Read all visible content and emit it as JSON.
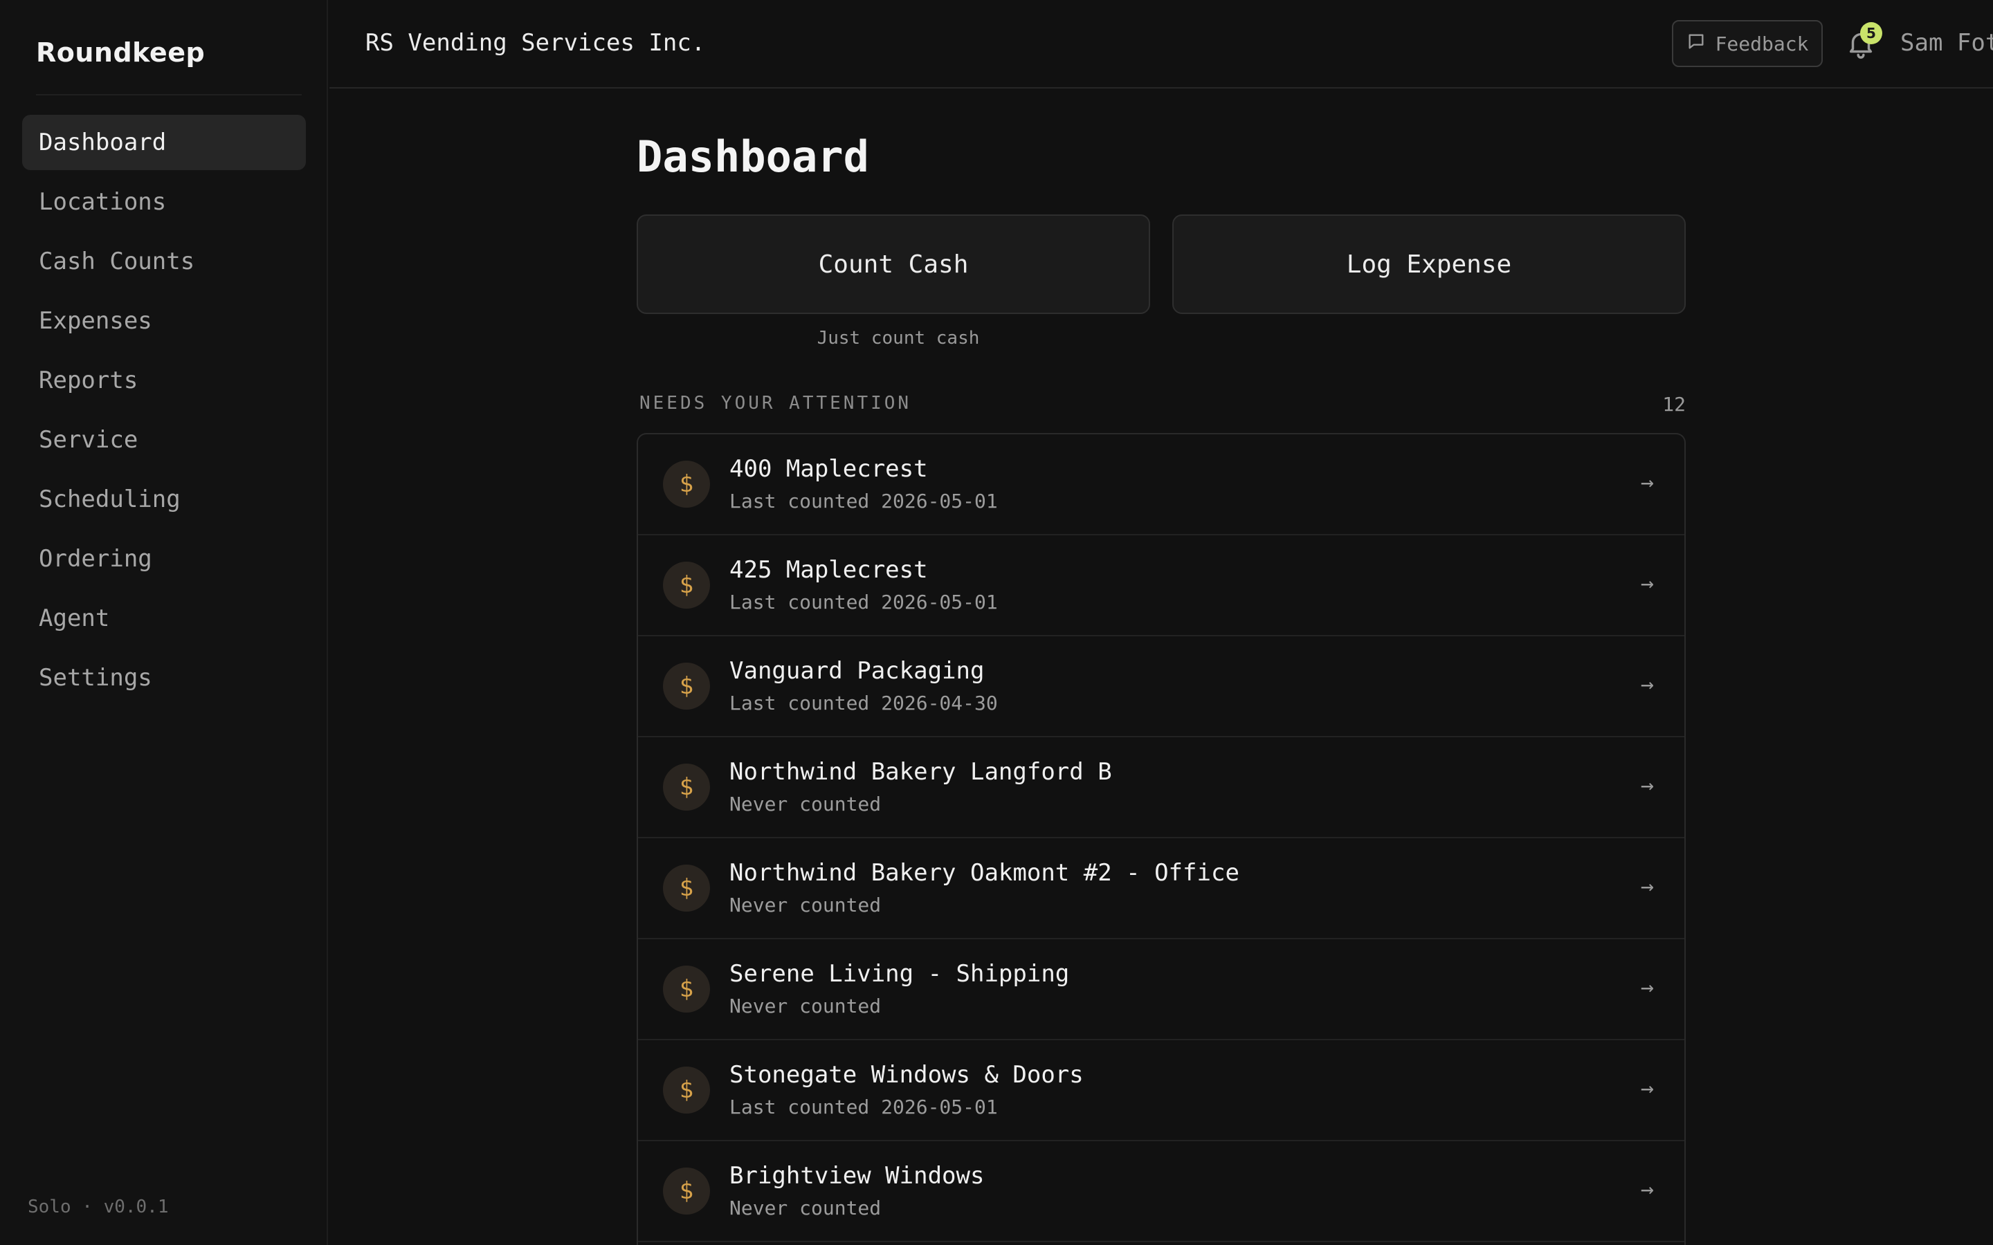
{
  "sidebar": {
    "brand": "Roundkeep",
    "items": [
      {
        "label": "Dashboard"
      },
      {
        "label": "Locations"
      },
      {
        "label": "Cash Counts"
      },
      {
        "label": "Expenses"
      },
      {
        "label": "Reports"
      },
      {
        "label": "Service"
      },
      {
        "label": "Scheduling"
      },
      {
        "label": "Ordering"
      },
      {
        "label": "Agent"
      },
      {
        "label": "Settings"
      }
    ],
    "active_item": "Dashboard",
    "footer": "Solo · v0.0.1"
  },
  "header": {
    "org_name": "RS Vending Services Inc.",
    "feedback_label": "Feedback",
    "notification_count": "5",
    "user_name": "Sam Fot"
  },
  "main": {
    "title": "Dashboard",
    "actions": {
      "count_cash": "Count Cash",
      "count_cash_sub": "Just count cash",
      "log_expense": "Log Expense"
    },
    "attention": {
      "label": "NEEDS YOUR ATTENTION",
      "count": "12",
      "items": [
        {
          "icon": "$",
          "title": "400 Maplecrest",
          "subtitle": "Last counted 2026-05-01",
          "arrow": "→"
        },
        {
          "icon": "$",
          "title": "425 Maplecrest",
          "subtitle": "Last counted 2026-05-01",
          "arrow": "→"
        },
        {
          "icon": "$",
          "title": "Vanguard Packaging",
          "subtitle": "Last counted 2026-04-30",
          "arrow": "→"
        },
        {
          "icon": "$",
          "title": "Northwind Bakery Langford B",
          "subtitle": "Never counted",
          "arrow": "→"
        },
        {
          "icon": "$",
          "title": "Northwind Bakery Oakmont #2 - Office",
          "subtitle": "Never counted",
          "arrow": "→"
        },
        {
          "icon": "$",
          "title": "Serene Living - Shipping",
          "subtitle": "Never counted",
          "arrow": "→"
        },
        {
          "icon": "$",
          "title": "Stonegate Windows & Doors",
          "subtitle": "Last counted 2026-05-01",
          "arrow": "→"
        },
        {
          "icon": "$",
          "title": "Brightview Windows",
          "subtitle": "Never counted",
          "arrow": "→"
        }
      ]
    }
  },
  "colors": {
    "background": "#111111",
    "accent_badge": "#c9e36a",
    "dollar_icon": "#d7a24a"
  }
}
